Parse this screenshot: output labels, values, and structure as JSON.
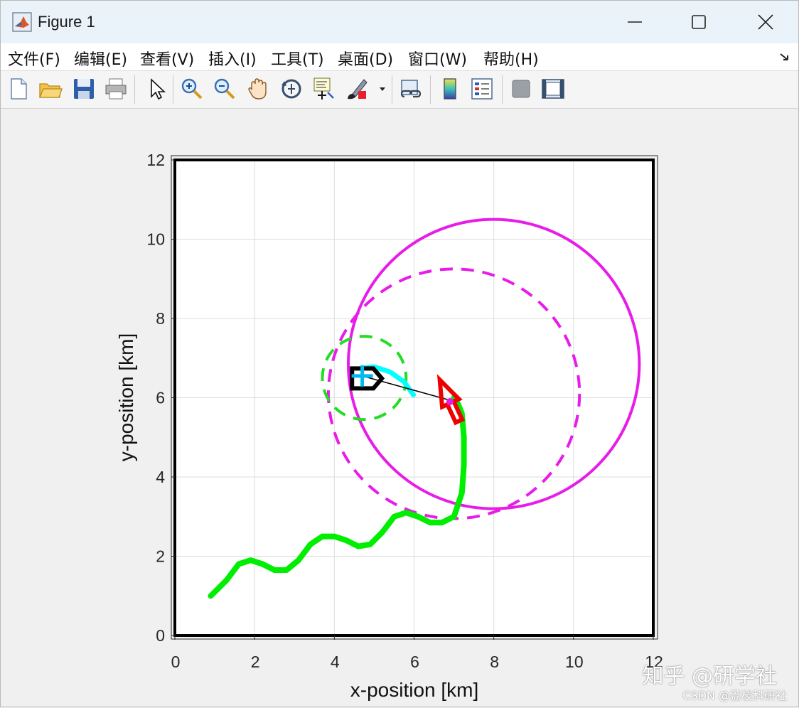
{
  "window": {
    "title": "Figure 1",
    "app_icon": "matlab-logo-icon"
  },
  "menu": {
    "items": [
      "文件(F)",
      "编辑(E)",
      "查看(V)",
      "插入(I)",
      "工具(T)",
      "桌面(D)",
      "窗口(W)",
      "帮助(H)"
    ]
  },
  "toolbar": {
    "icons": [
      "new-figure-icon",
      "open-file-icon",
      "save-icon",
      "print-icon",
      "pointer-icon",
      "zoom-in-icon",
      "zoom-out-icon",
      "pan-hand-icon",
      "rotate-3d-icon",
      "data-cursor-icon",
      "brush-icon",
      "link-plot-icon",
      "colorbar-icon",
      "legend-icon",
      "hide-plot-tools-icon",
      "show-plot-tools-icon"
    ]
  },
  "watermark": {
    "text": "知乎 @研学社",
    "sub": "CSDN @荔枝科研社"
  },
  "chart_data": {
    "type": "line",
    "xlabel": "x-position [km]",
    "ylabel": "y-position [km]",
    "xlim": [
      0,
      12
    ],
    "ylim": [
      0,
      12
    ],
    "x_ticks": [
      0,
      2,
      4,
      6,
      8,
      10,
      12
    ],
    "y_ticks": [
      0,
      2,
      4,
      6,
      8,
      10,
      12
    ],
    "grid": true,
    "series": [
      {
        "color": "#00ee00",
        "style": "solid-thick",
        "x": [
          0.9,
          1.3,
          1.6,
          1.9,
          2.2,
          2.5,
          2.8,
          3.1,
          3.4,
          3.7,
          4.0,
          4.3,
          4.6,
          4.9,
          5.2,
          5.5,
          5.8,
          6.1,
          6.4,
          6.7,
          7.0,
          7.2,
          7.25,
          7.25,
          7.2,
          7.1,
          7.0
        ],
        "y": [
          1.0,
          1.4,
          1.8,
          1.9,
          1.8,
          1.65,
          1.65,
          1.9,
          2.3,
          2.5,
          2.5,
          2.4,
          2.25,
          2.3,
          2.6,
          3.0,
          3.1,
          3.0,
          2.85,
          2.85,
          3.0,
          3.6,
          4.3,
          5.0,
          5.6,
          5.85,
          6.0
        ]
      },
      {
        "color": "#00ffff",
        "style": "dotted",
        "x": [
          4.7,
          5.0,
          5.4,
          5.75,
          6.0
        ],
        "y": [
          6.75,
          6.78,
          6.65,
          6.4,
          6.05
        ]
      }
    ],
    "circles": [
      {
        "cx": 8.0,
        "cy": 6.85,
        "r": 3.65,
        "color": "#e81ce8",
        "style": "solid"
      },
      {
        "cx": 7.0,
        "cy": 6.1,
        "r": 3.15,
        "color": "#e81ce8",
        "style": "dashed"
      },
      {
        "cx": 4.75,
        "cy": 6.5,
        "r": 1.05,
        "color": "#22dd22",
        "style": "dashed"
      }
    ],
    "los_line": {
      "x": [
        4.7,
        6.85
      ],
      "y": [
        6.55,
        5.95
      ],
      "color": "#000000"
    },
    "markers": [
      {
        "type": "red-arrow",
        "x": 6.9,
        "y": 5.9,
        "color": "#ee0000"
      },
      {
        "type": "black-ship",
        "x": 4.8,
        "y": 6.45,
        "color": "#000000"
      },
      {
        "type": "cyan-cross",
        "x": 4.7,
        "y": 6.55,
        "color": "#00bbee"
      }
    ]
  }
}
